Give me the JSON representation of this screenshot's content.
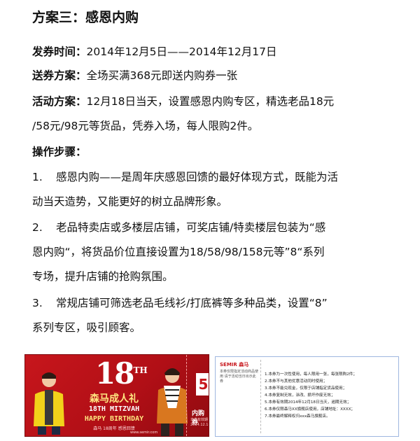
{
  "title": "方案三：感恩内购",
  "issue_time": {
    "label": "发券时间：",
    "value": "2014年12月5日——2014年12月17日"
  },
  "send_plan": {
    "label": "送券方案：",
    "value": "全场买满368元即送内购券一张"
  },
  "activity_plan": {
    "label": "活动方案：",
    "line1": "12月18日当天，设置感恩内购专区，精选老品18元",
    "line2": "/58元/98元等货品，凭券入场，每人限购2件。"
  },
  "steps_heading": "操作步骤：",
  "steps": [
    {
      "num": "1.",
      "line1": "感恩内购——是周年庆感恩回馈的最好体现方式，既能为活",
      "line2": "动当天造势，又能更好的树立品牌形象。"
    },
    {
      "num": "2.",
      "line1": "老品特卖店或多楼层店铺，可奖店铺/特卖楼层包装为“感",
      "line2": "恩内购“，将货品价位直接设置为18/58/98/158元等”8“系列",
      "line3": "专场，提升店铺的抢购氛围。"
    },
    {
      "num": "3.",
      "line1": "常规店铺可筛选老品毛线衫/打底裤等多种品类，设置“8”",
      "line2": "系列专区，吸引顾客。"
    }
  ],
  "coupon_front": {
    "number": "18",
    "number_sup": "TH",
    "banner": "森马成人礼",
    "mitzvah": "18TH MITZVAH",
    "happy_birthday": "HAPPY BIRTHDAY",
    "small_note": "森马 18周年 感恩回馈",
    "discount": "5",
    "discount_unit": "折",
    "ticket_label": "内购券",
    "ticket_sub": "本券有效期 2014.12.18",
    "site": "www.semir.com"
  },
  "coupon_back": {
    "logo": "SEMIR 森马",
    "left_text": "本券仅限指定活动商品使用 请于活动当日出示此券",
    "rules": [
      "1.本券为一次性使用，每人限用一张，每张限购2件；",
      "2.本券不与其他优惠活动同时使用；",
      "3.本券不能兑现金，仅限于店铺指定货品使用；",
      "4.本券复制无效，涂改、损坏作废无效；",
      "5.本券有效期2014年12月18日当天，逾期无效；",
      "6.本券仅限森马XX旗舰店使用，店铺地址：XXXX；",
      "7.本券最终解释权归xxx森马旗舰店。"
    ]
  },
  "colors": {
    "brand_red": "#c7161c",
    "frame_blue": "#9fb7e0"
  }
}
